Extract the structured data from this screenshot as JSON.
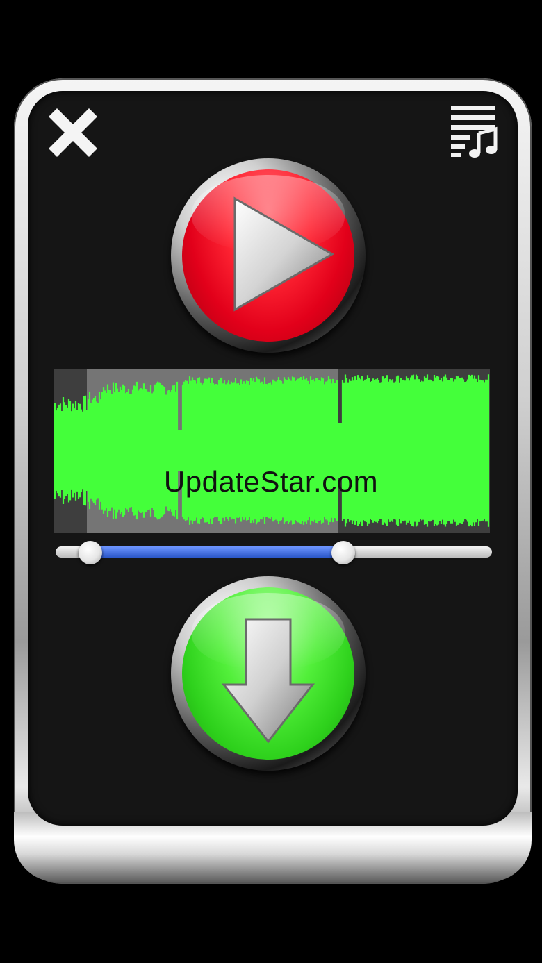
{
  "app": {
    "watermark": "UpdateStar.com"
  },
  "icons": {
    "close": "close-icon",
    "playlist": "playlist-music-icon",
    "play": "play-icon",
    "download": "download-arrow-icon"
  },
  "colors": {
    "play_button": "#ff2634",
    "download_button": "#3ee028",
    "waveform": "#44ff3a",
    "selection_range": "#3b66d9",
    "background": "#151515"
  },
  "trim": {
    "start_fraction": 0.08,
    "end_fraction": 0.66
  }
}
